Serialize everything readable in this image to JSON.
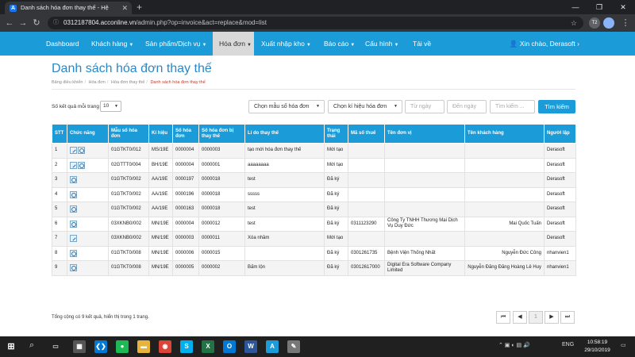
{
  "browser": {
    "tab_title": "Danh sách hóa đơn thay thế - Hệ",
    "tab_favicon": "A",
    "url_host": "0312187804.acconline.vn",
    "url_path": "/admin.php?op=invoice&act=replace&mod=list",
    "colors": {
      "tabbar": "#202124",
      "toolbar": "#35363a"
    }
  },
  "navbar": {
    "items": [
      {
        "label": "Dashboard",
        "caret": false
      },
      {
        "label": "Khách hàng",
        "caret": true
      },
      {
        "label": "Sản phẩm/Dịch vụ",
        "caret": true
      },
      {
        "label": "Hóa đơn",
        "caret": true,
        "active": true
      },
      {
        "label": "Xuất nhập kho",
        "caret": true
      },
      {
        "label": "Báo cáo",
        "caret": true
      },
      {
        "label": "Cấu hình",
        "caret": true
      },
      {
        "label": "Tải về",
        "caret": false
      }
    ],
    "user": "Xin chào, Derasoft",
    "user_icon": "user-icon",
    "accent": "#1b9bd7"
  },
  "page": {
    "title": "Danh sách hóa đơn thay thế",
    "breadcrumb": [
      "Bảng điều khiển",
      "Hóa đơn",
      "Hóa đơn thay thế",
      "Danh sách hóa đơn thay thế"
    ]
  },
  "filters": {
    "perpage_label": "Số kết quả mỗi trang",
    "perpage_value": "10",
    "serial_select": "Chọn mẫu số hóa đơn",
    "symbol_select": "Chọn kí hiệu hóa đơn",
    "from_date_placeholder": "Từ ngày",
    "to_date_placeholder": "Đến ngày",
    "search_placeholder": "Tìm kiếm ...",
    "search_button": "Tìm kiếm"
  },
  "table": {
    "headers": [
      "STT",
      "Chức năng",
      "Mẫu số hóa đơn",
      "Kí hiệu",
      "Số hóa đơn",
      "Số hóa đơn bị thay thế",
      "Lí do thay thế",
      "Trạng thái",
      "Mã số thuế",
      "Tên đơn vị",
      "Tên khách hàng",
      "Người lập"
    ],
    "rows": [
      {
        "stt": "1",
        "actions": [
          "edit",
          "view"
        ],
        "form": "01GTKT0/012",
        "symbol": "MS/19E",
        "number": "0000004",
        "replaced": "0000003",
        "reason": "tạo mới hóa đơn thay thế",
        "status": "Mới tạo",
        "tax": "",
        "unit": "",
        "customer": "",
        "creator": "Derasoft"
      },
      {
        "stt": "2",
        "actions": [
          "edit",
          "view"
        ],
        "form": "02GTTT0/004",
        "symbol": "BH/19E",
        "number": "0000004",
        "replaced": "0000001",
        "reason": "aaaaaaaa",
        "status": "Mới tạo",
        "tax": "",
        "unit": "",
        "customer": "",
        "creator": "Derasoft"
      },
      {
        "stt": "3",
        "actions": [
          "view"
        ],
        "form": "01GTKT0/002",
        "symbol": "AA/19E",
        "number": "0000197",
        "replaced": "0000018",
        "reason": "test",
        "status": "Đã ký",
        "tax": "",
        "unit": "",
        "customer": "",
        "creator": "Derasoft"
      },
      {
        "stt": "4",
        "actions": [
          "view"
        ],
        "form": "01GTKT0/002",
        "symbol": "AA/19E",
        "number": "0000196",
        "replaced": "0000018",
        "reason": "sssss",
        "status": "Đã ký",
        "tax": "",
        "unit": "",
        "customer": "",
        "creator": "Derasoft"
      },
      {
        "stt": "5",
        "actions": [
          "view"
        ],
        "form": "01GTKT0/002",
        "symbol": "AA/19E",
        "number": "0000163",
        "replaced": "0000018",
        "reason": "test",
        "status": "Đã ký",
        "tax": "",
        "unit": "",
        "customer": "",
        "creator": "Derasoft"
      },
      {
        "stt": "6",
        "actions": [
          "view"
        ],
        "form": "03XKNB0/002",
        "symbol": "MN/19E",
        "number": "0000004",
        "replaced": "0000012",
        "reason": "test",
        "status": "Đã ký",
        "tax": "0311123290",
        "unit": "Công Ty TNHH Thương Mại Dịch Vụ Duy Đức",
        "customer": "Mai Quốc Tuấn",
        "creator": "Derasoft"
      },
      {
        "stt": "7",
        "actions": [
          "edit"
        ],
        "form": "03XKNB0/002",
        "symbol": "MN/19E",
        "number": "0000003",
        "replaced": "0000011",
        "reason": "Xóa nhầm",
        "status": "Mới tạo",
        "tax": "",
        "unit": "",
        "customer": "",
        "creator": "Derasoft"
      },
      {
        "stt": "8",
        "actions": [
          "view"
        ],
        "form": "01GTKT0/008",
        "symbol": "MN/19E",
        "number": "0000006",
        "replaced": "0000015",
        "reason": "",
        "status": "Đã ký",
        "tax": "0301261735",
        "unit": "Bệnh Viện Thống Nhất",
        "customer": "Nguyễn Đức Công",
        "creator": "nhanvien1"
      },
      {
        "stt": "9",
        "actions": [
          "view"
        ],
        "form": "01GTKT0/008",
        "symbol": "MN/19E",
        "number": "0000005",
        "replaced": "0000002",
        "reason": "Bấm lộn",
        "status": "Đã ký",
        "tax": "03012617000",
        "unit": "Digital Era Software Company Limited",
        "customer": "Nguyễn Đăng Đăng Hoàng Lê Huy",
        "creator": "nhanvien1"
      }
    ]
  },
  "footer": {
    "summary": "Tổng cộng có 9 kết quả, hiển thị trong 1 trang.",
    "pager": [
      "⏮",
      "◀",
      "1",
      "▶",
      "⏭"
    ]
  },
  "taskbar": {
    "apps": [
      {
        "name": "calculator-icon",
        "glyph": "▦",
        "color": "#555"
      },
      {
        "name": "vscode-icon",
        "glyph": "❮❯",
        "color": "#0078d4"
      },
      {
        "name": "spotify-icon",
        "glyph": "●",
        "color": "#1db954"
      },
      {
        "name": "folder-icon",
        "glyph": "▬",
        "color": "#e8b339"
      },
      {
        "name": "chrome-icon",
        "glyph": "◉",
        "color": "#db4437"
      },
      {
        "name": "skype-icon",
        "glyph": "S",
        "color": "#00aff0"
      },
      {
        "name": "excel-icon",
        "glyph": "X",
        "color": "#217346"
      },
      {
        "name": "outlook-icon",
        "glyph": "O",
        "color": "#0078d4"
      },
      {
        "name": "word-icon",
        "glyph": "W",
        "color": "#2b579a"
      },
      {
        "name": "app-a-icon",
        "glyph": "A",
        "color": "#1b9bd7"
      },
      {
        "name": "paint-icon",
        "glyph": "✎",
        "color": "#777"
      }
    ],
    "lang": "ENG",
    "time": "10:58:19",
    "date": "29/10/2019"
  }
}
